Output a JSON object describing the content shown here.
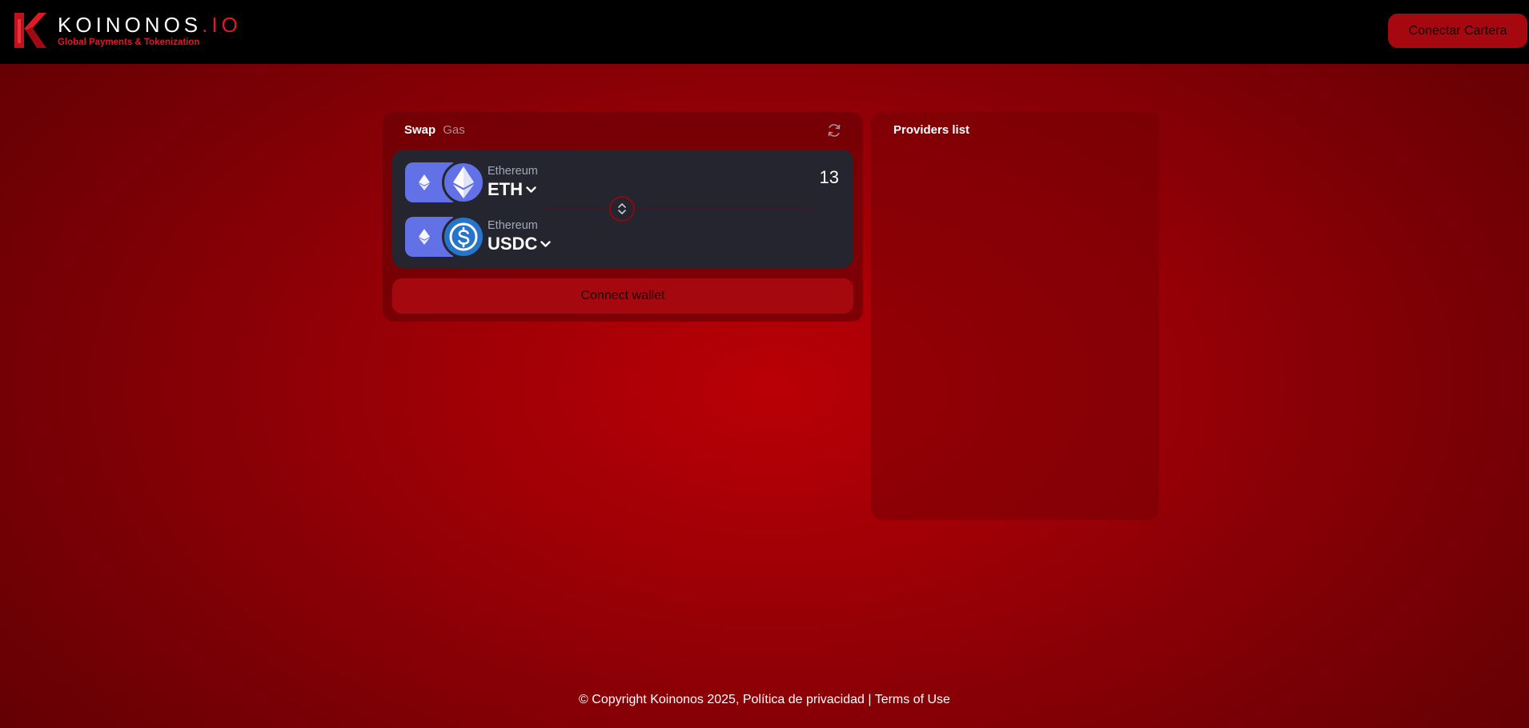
{
  "header": {
    "logo_name": "KOINONOS",
    "logo_tld": ".IO",
    "logo_tagline": "Global Payments & Tokenization",
    "connect_label": "Conectar Cartera"
  },
  "swap": {
    "tabs": [
      {
        "label": "Swap",
        "active": true
      },
      {
        "label": "Gas",
        "active": false
      }
    ],
    "from": {
      "network": "Ethereum",
      "token": "ETH",
      "amount": "13",
      "icon": "eth-icon"
    },
    "to": {
      "network": "Ethereum",
      "token": "USDC",
      "icon": "usdc-icon"
    },
    "connect_label": "Connect wallet"
  },
  "providers": {
    "title": "Providers list"
  },
  "footer": {
    "copyright": "© Copyright Koinonos 2025,",
    "privacy": "Política de privacidad",
    "separator": "|",
    "terms": "Terms of Use"
  },
  "colors": {
    "brand_red": "#e01a24",
    "button_red": "#a5090f",
    "panel_dark": "#24252f",
    "eth_blue": "#6271e5",
    "usdc_blue": "#2775ca"
  }
}
